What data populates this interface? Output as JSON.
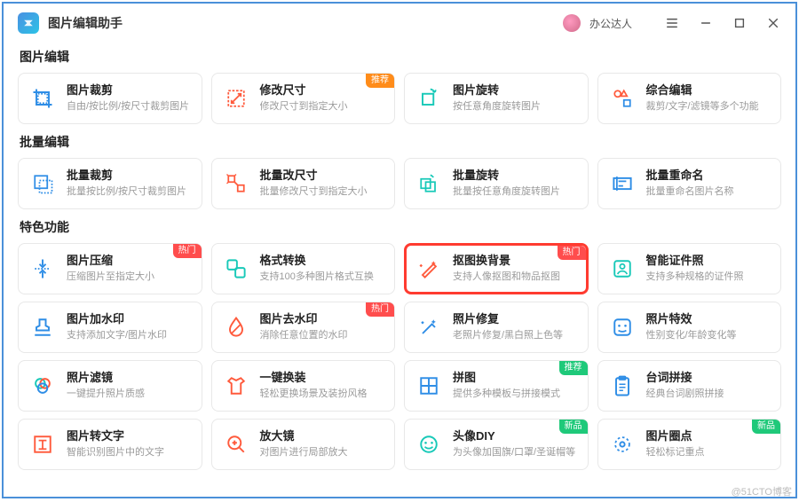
{
  "app": {
    "title": "图片编辑助手",
    "username": "办公达人"
  },
  "badges": {
    "recommend": "推荐",
    "hot": "热门",
    "new": "新品"
  },
  "sections": [
    {
      "title": "图片编辑",
      "cards": [
        {
          "id": "crop",
          "title": "图片裁剪",
          "desc": "自由/按比例/按尺寸裁剪图片",
          "icon": "crop",
          "color": "#2e8de6"
        },
        {
          "id": "resize",
          "title": "修改尺寸",
          "desc": "修改尺寸到指定大小",
          "icon": "resize",
          "color": "#ff5a3c",
          "badge": "recommend",
          "badgeColor": "orange"
        },
        {
          "id": "rotate",
          "title": "图片旋转",
          "desc": "按任意角度旋转图片",
          "icon": "rotate",
          "color": "#18c9b8"
        },
        {
          "id": "combo",
          "title": "综合编辑",
          "desc": "裁剪/文字/滤镜等多个功能",
          "icon": "shapes",
          "color": "#ff5a3c"
        }
      ]
    },
    {
      "title": "批量编辑",
      "cards": [
        {
          "id": "batch-crop",
          "title": "批量裁剪",
          "desc": "批量按比例/按尺寸裁剪图片",
          "icon": "batch-crop",
          "color": "#2e8de6"
        },
        {
          "id": "batch-resize",
          "title": "批量改尺寸",
          "desc": "批量修改尺寸到指定大小",
          "icon": "batch-resize",
          "color": "#ff5a3c"
        },
        {
          "id": "batch-rotate",
          "title": "批量旋转",
          "desc": "批量按任意角度旋转图片",
          "icon": "batch-rotate",
          "color": "#18c9b8"
        },
        {
          "id": "batch-rename",
          "title": "批量重命名",
          "desc": "批量重命名图片名称",
          "icon": "rename",
          "color": "#2e8de6"
        }
      ]
    },
    {
      "title": "特色功能",
      "cards": [
        {
          "id": "compress",
          "title": "图片压缩",
          "desc": "压缩图片至指定大小",
          "icon": "compress",
          "color": "#2e8de6",
          "badge": "hot",
          "badgeColor": "red"
        },
        {
          "id": "convert",
          "title": "格式转换",
          "desc": "支持100多种图片格式互换",
          "icon": "convert",
          "color": "#18c9b8"
        },
        {
          "id": "cutout",
          "title": "抠图换背景",
          "desc": "支持人像抠图和物品抠图",
          "icon": "wand",
          "color": "#ff5a3c",
          "badge": "hot",
          "badgeColor": "red",
          "highlighted": true
        },
        {
          "id": "idphoto",
          "title": "智能证件照",
          "desc": "支持多种规格的证件照",
          "icon": "idphoto",
          "color": "#18c9b8"
        },
        {
          "id": "add-wm",
          "title": "图片加水印",
          "desc": "支持添加文字/图片水印",
          "icon": "stamp",
          "color": "#2e8de6"
        },
        {
          "id": "remove-wm",
          "title": "图片去水印",
          "desc": "消除任意位置的水印",
          "icon": "droplet",
          "color": "#ff5a3c",
          "badge": "hot",
          "badgeColor": "red"
        },
        {
          "id": "repair",
          "title": "照片修复",
          "desc": "老照片修复/黑白照上色等",
          "icon": "sparkle",
          "color": "#2e8de6"
        },
        {
          "id": "effects",
          "title": "照片特效",
          "desc": "性别变化/年龄变化等",
          "icon": "face",
          "color": "#2e8de6"
        },
        {
          "id": "filter",
          "title": "照片滤镜",
          "desc": "一键提升照片质感",
          "icon": "filter",
          "color": "#18c9b8"
        },
        {
          "id": "dress",
          "title": "一键换装",
          "desc": "轻松更换场景及装扮风格",
          "icon": "tshirt",
          "color": "#ff5a3c"
        },
        {
          "id": "puzzle",
          "title": "拼图",
          "desc": "提供多种模板与拼接模式",
          "icon": "puzzle",
          "color": "#2e8de6",
          "badge": "recommend",
          "badgeColor": "green"
        },
        {
          "id": "lines",
          "title": "台词拼接",
          "desc": "经典台词剧照拼接",
          "icon": "clipboard",
          "color": "#2e8de6"
        },
        {
          "id": "ocr",
          "title": "图片转文字",
          "desc": "智能识别图片中的文字",
          "icon": "ocr",
          "color": "#ff5a3c"
        },
        {
          "id": "zoom",
          "title": "放大镜",
          "desc": "对图片进行局部放大",
          "icon": "zoom",
          "color": "#ff5a3c"
        },
        {
          "id": "avatar-diy",
          "title": "头像DIY",
          "desc": "为头像加国旗/口罩/圣诞帽等",
          "icon": "smiley",
          "color": "#18c9b8",
          "badge": "new",
          "badgeColor": "green"
        },
        {
          "id": "focus",
          "title": "图片圈点",
          "desc": "轻松标记重点",
          "icon": "target",
          "color": "#2e8de6",
          "badge": "new",
          "badgeColor": "green"
        }
      ]
    }
  ],
  "watermark": "@51CTO博客"
}
